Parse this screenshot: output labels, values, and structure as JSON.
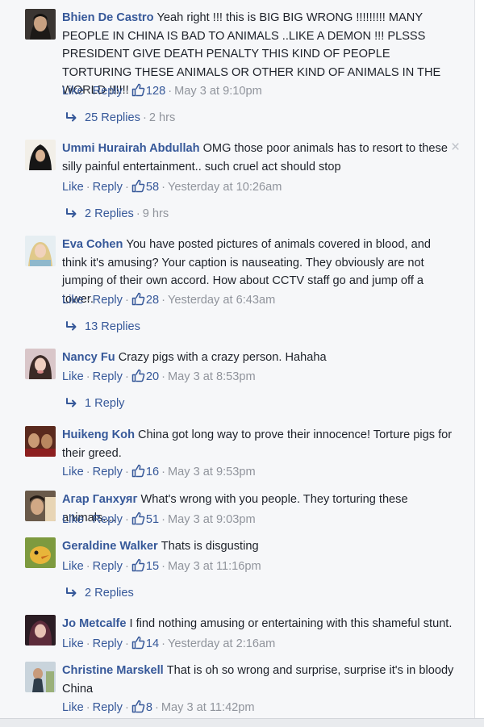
{
  "actions": {
    "like": "Like",
    "reply": "Reply",
    "separator": "·"
  },
  "colors": {
    "link": "#365899",
    "meta": "#90949c",
    "text": "#1d2129"
  },
  "comments": [
    {
      "author": "Bhien De Castro",
      "text": "Yeah right !!! this is BIG BIG WRONG !!!!!!!!! MANY PEOPLE IN CHINA IS BAD TO ANIMALS ..LIKE A DEMON !!! PLSSS PRESIDENT GIVE DEATH PENALTY THIS KIND OF PEOPLE TORTURING THESE ANIMALS OR OTHER KIND OF ANIMALS IN THE WORLD !!!!!!",
      "likes": "128",
      "time": "May 3 at 9:10pm",
      "replies": {
        "label": "25 Replies",
        "time": "2 hrs"
      }
    },
    {
      "author": "Ummi Hurairah Abdullah",
      "text": "OMG those poor animals has to resort to these silly painful entertainment.. such cruel act should stop",
      "likes": "58",
      "time": "Yesterday at 10:26am",
      "close_icon": "×",
      "replies": {
        "label": "2 Replies",
        "time": "9 hrs"
      }
    },
    {
      "author": "Eva Cohen",
      "text": "You have posted pictures of animals covered in blood, and think it's amusing? Your caption is nauseating. They obviously are not jumping of their own accord. How about CCTV staff go and jump off a tower.",
      "likes": "28",
      "time": "Yesterday at 6:43am",
      "replies": {
        "label": "13 Replies"
      }
    },
    {
      "author": "Nancy Fu",
      "text": "Crazy pigs with a crazy person. Hahaha",
      "likes": "20",
      "time": "May 3 at 8:53pm",
      "replies": {
        "label": "1 Reply"
      }
    },
    {
      "author": "Huikeng Koh",
      "text": "China got long way to prove their innocence! Torture pigs for their greed.",
      "likes": "16",
      "time": "May 3 at 9:53pm"
    },
    {
      "author": "Агар Ганхуяг",
      "text": "What's wrong with you people. They torturing these animals....",
      "likes": "51",
      "time": "May 3 at 9:03pm"
    },
    {
      "author": "Geraldine Walker",
      "text": "Thats is disgusting",
      "likes": "15",
      "time": "May 3 at 11:16pm",
      "replies": {
        "label": "2 Replies"
      }
    },
    {
      "author": "Jo Metcalfe",
      "text": "I find nothing amusing or entertaining with this shameful stunt.",
      "likes": "14",
      "time": "Yesterday at 2:16am"
    },
    {
      "author": "Christine Marskell",
      "text": "That is oh so wrong and surprise, surprise it's in bloody China",
      "likes": "8",
      "time": "May 3 at 11:42pm"
    }
  ]
}
